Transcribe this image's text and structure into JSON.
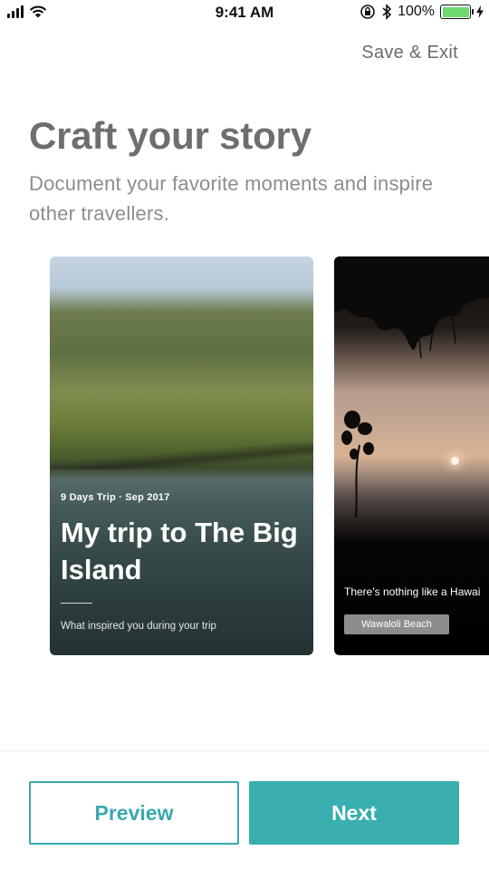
{
  "status_bar": {
    "time": "9:41 AM",
    "battery_percent": "100%",
    "signal_bars": 4,
    "battery_level": 1.0
  },
  "header": {
    "save_exit_label": "Save & Exit",
    "title": "Craft your story",
    "subtitle": "Document your favorite moments and inspire other travellers."
  },
  "cards": [
    {
      "kicker": "9 Days Trip · Sep 2017",
      "title": "My trip to The Big Island",
      "prompt": "What inspired you during your trip"
    },
    {
      "caption": "There's nothing like a Hawai",
      "tag": "Wawaloli Beach"
    }
  ],
  "footer": {
    "preview_label": "Preview",
    "next_label": "Next"
  },
  "colors": {
    "accent": "#3aafb0",
    "title_gray": "#6e6e6e",
    "subtitle_gray": "#8d8d8d"
  },
  "icons": [
    "signal-icon",
    "wifi-icon",
    "orientation-lock-icon",
    "bluetooth-icon",
    "battery-icon",
    "charging-bolt-icon"
  ]
}
